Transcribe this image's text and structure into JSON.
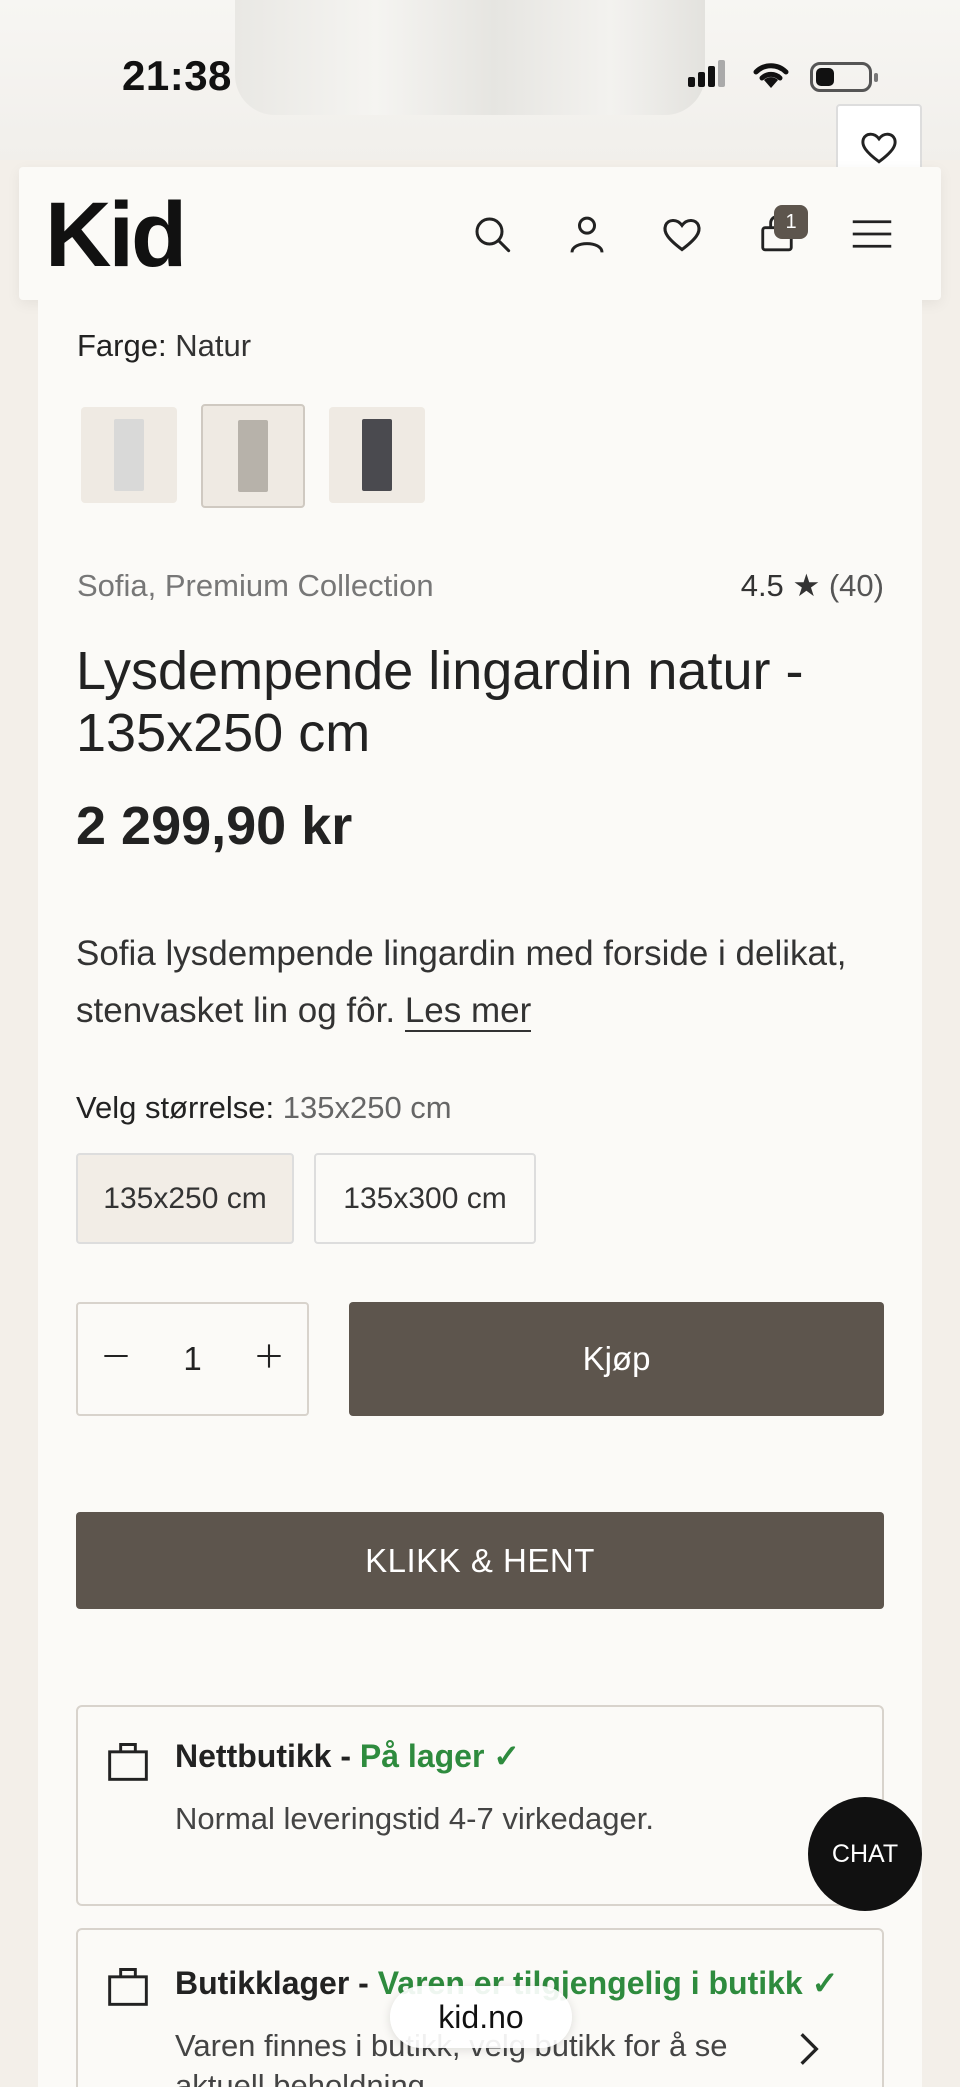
{
  "status_bar": {
    "time": "21:38"
  },
  "header": {
    "logo": "Kid",
    "cart_count": "1",
    "icons": [
      "search-icon",
      "user-icon",
      "heart-icon",
      "bag-icon",
      "menu-icon"
    ]
  },
  "product": {
    "color_label": "Farge:",
    "color_value": "Natur",
    "swatches": [
      {
        "name": "hvit",
        "color": "#d9d9d8"
      },
      {
        "name": "natur",
        "color": "#b7b2aa"
      },
      {
        "name": "mørk grå",
        "color": "#4a4a4f"
      }
    ],
    "brand": "Sofia, Premium Collection",
    "rating": "4.5",
    "rating_star": "★",
    "review_count": "(40)",
    "title": "Lysdempende lingardin natur - 135x250 cm",
    "price": "2 299,90 kr",
    "description": "Sofia lysdempende lingardin med forside i delikat, stenvasket lin og fôr.",
    "read_more": "Les mer",
    "size_label": "Velg størrelse:",
    "size_selected": "135x250 cm",
    "sizes": [
      "135x250 cm",
      "135x300 cm"
    ],
    "quantity": "1",
    "buy_label": "Kjøp",
    "click_collect_label": "KLIKK & HENT"
  },
  "stock": {
    "online": {
      "title": "Nettbutikk - ",
      "status": "På lager ✓",
      "text": "Normal leveringstid 4-7 virkedager."
    },
    "store": {
      "title": "Butikklager - ",
      "status": "Varen er tilgjengelig i butikk ✓",
      "text": "Varen finnes i butikk, velg butikk for å se aktuell beholdning"
    }
  },
  "chat_label": "CHAT",
  "browser": {
    "url": "kid.no"
  },
  "colors": {
    "accent": "#5d554d",
    "in_stock": "#2e8b3e"
  }
}
